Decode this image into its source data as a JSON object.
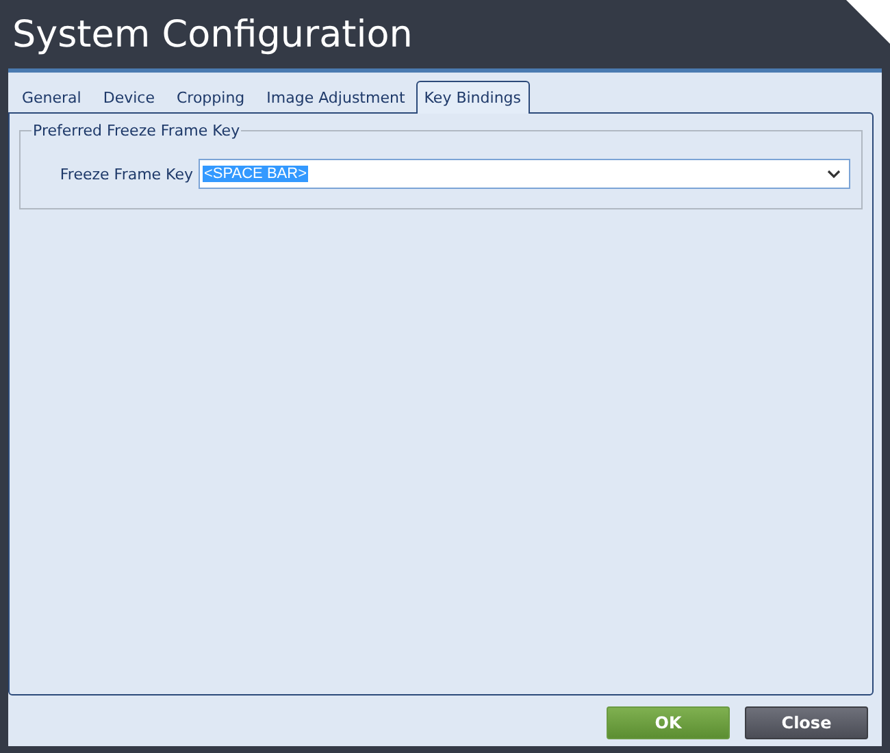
{
  "window": {
    "title": "System Configuration"
  },
  "tabs": [
    {
      "label": "General",
      "selected": false
    },
    {
      "label": "Device",
      "selected": false
    },
    {
      "label": "Cropping",
      "selected": false
    },
    {
      "label": "Image Adjustment",
      "selected": false
    },
    {
      "label": "Key Bindings",
      "selected": true
    }
  ],
  "group": {
    "title": "Preferred Freeze Frame Key",
    "field": {
      "label": "Freeze Frame Key",
      "value": "<SPACE BAR>"
    }
  },
  "buttons": [
    {
      "label": "OK",
      "kind": "primary"
    },
    {
      "label": "Close",
      "kind": "secondary"
    }
  ]
}
